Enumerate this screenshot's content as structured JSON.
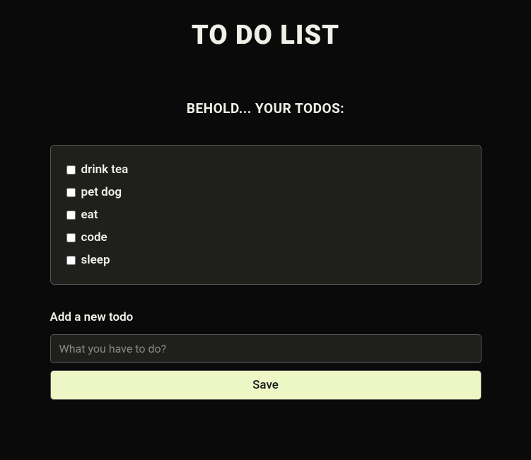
{
  "title": "TO DO LIST",
  "subtitle": "BEHOLD... YOUR TODOS:",
  "todos": [
    {
      "label": "drink tea",
      "checked": false
    },
    {
      "label": "pet dog",
      "checked": false
    },
    {
      "label": "eat",
      "checked": false
    },
    {
      "label": "code",
      "checked": false
    },
    {
      "label": "sleep",
      "checked": false
    }
  ],
  "form": {
    "label": "Add a new todo",
    "placeholder": "What you have to do?",
    "value": "",
    "save_label": "Save"
  }
}
